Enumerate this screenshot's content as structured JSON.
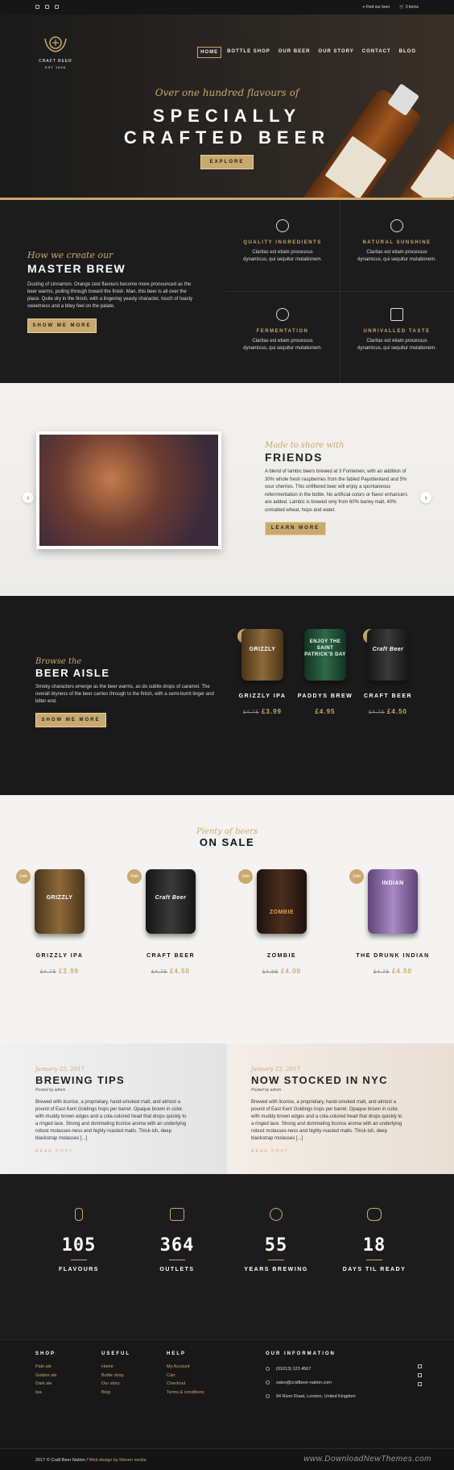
{
  "topbar": {
    "social_icons": [
      "instagram-icon",
      "facebook-icon",
      "twitter-icon"
    ],
    "find_beer": "Find our beer",
    "cart": "0 items"
  },
  "hero": {
    "brand": "CRAFT BEER",
    "established": "EST 1926",
    "nav": [
      "HOME",
      "BOTTLE SHOP",
      "OUR BEER",
      "OUR STORY",
      "CONTACT",
      "BLOG"
    ],
    "active_nav": "HOME",
    "tagline": "Over one hundred flavours of",
    "title_line1": "SPECIALLY",
    "title_line2": "CRAFTED BEER",
    "cta": "EXPLORE"
  },
  "brew": {
    "kicker": "How we create our",
    "title": "MASTER BREW",
    "text": "Dusting of cinnamon. Orange zest flavours become more pronounced as the beer warms, pulling through toward the finish. Man, this beer is all over the place. Quite dry in the finish, with a lingering yeasty character, touch of toasty sweetness and a bitey feel on the palate.",
    "cta": "SHOW ME MORE",
    "features": [
      {
        "title": "QUALITY INGREDIENTS",
        "text": "Claritas est etiam processus dynamicus, qui sequitur mutationem.",
        "icon": "hops-icon"
      },
      {
        "title": "NATURAL SUNSHINE",
        "text": "Claritas est etiam processus dynamicus, qui sequitur mutationem.",
        "icon": "sun-icon"
      },
      {
        "title": "FERMENTATION",
        "text": "Claritas est etiam processus dynamicus, qui sequitur mutationem.",
        "icon": "barrel-icon"
      },
      {
        "title": "UNRIVALLED TASTE",
        "text": "Claritas est etiam processus dynamicus, qui sequitur mutationem.",
        "icon": "crate-icon"
      }
    ]
  },
  "friends": {
    "kicker": "Made to share with",
    "title": "FRIENDS",
    "text": "A blend of lambic beers brewed at 3 Fonteinen, with an addition of 30% whole fresh raspberries from the fabled Payottenland and 5% sour cherries. This unfiltered beer will enjoy a spontaneous referrmentation in the bottle. No artificial colors or flavor enhancers are added. Lambic is brewed only from 60% barley malt, 40% unmalted wheat, hops and water.",
    "cta": "LEARN MORE",
    "prev": "‹",
    "next": "›"
  },
  "aisle": {
    "kicker": "Browse the",
    "title": "BEER AISLE",
    "text": "Smoky characters emerge as the beer warms, as do subtle drops of caramel. The overall dryness of the beer carries through to the finish, with a semi-burnt linger and bitter end.",
    "cta": "SHOW ME MORE",
    "sale_badge": "Sale",
    "products": [
      {
        "name": "GRIZZLY IPA",
        "old": "£4.75",
        "price": "£3.99",
        "sale": true,
        "can_label": "GRIZZLY",
        "color": "#7a5a32"
      },
      {
        "name": "PADDYS BREW",
        "old": "",
        "price": "£4.95",
        "sale": false,
        "can_label": "ENJOY THE SAINT PATRICK'S DAY",
        "color": "#1f4a33"
      },
      {
        "name": "CRAFT BEER",
        "old": "£4.75",
        "price": "£4.50",
        "sale": true,
        "can_label": "Craft Beer",
        "color": "#2a2a2a"
      }
    ]
  },
  "sale": {
    "kicker": "Plenty of beers",
    "title": "ON SALE",
    "badge": "Sale",
    "products": [
      {
        "name": "GRIZZLY IPA",
        "old": "£4.75",
        "price": "£2.99",
        "can_label": "GRIZZLY",
        "color": "#7a5a32"
      },
      {
        "name": "CRAFT BEER",
        "old": "£4.75",
        "price": "£4.50",
        "can_label": "Craft Beer",
        "color": "#2a2a2a"
      },
      {
        "name": "ZOMBIE",
        "old": "£4.95",
        "price": "£4.00",
        "can_label": "ZOMBIE",
        "color": "#3a2418"
      },
      {
        "name": "THE DRUNK INDIAN",
        "old": "£4.75",
        "price": "£4.50",
        "can_label": "INDIAN",
        "color": "#8a66a8"
      }
    ]
  },
  "blog": [
    {
      "date": "January 23, 2017",
      "title": "BREWING TIPS",
      "by": "Posted by admin",
      "text": "Brewed with licorice, a proprietary, hand-smoked malt, and almost a pound of East Kent Goldings hops per barrel. Opaque brown in color, with muddy brown edges and a cola-colored head that drops quickly to a ringed lace. Strong and dominating licorice aroma with an underlying robust molasses-ness and highly roasted malts. Thick-ish, deep blackstrap molasses [...]",
      "more": "READ POST"
    },
    {
      "date": "January 23, 2017",
      "title": "NOW STOCKED IN NYC",
      "by": "Posted by admin",
      "text": "Brewed with licorice, a proprietary, hand-smoked malt, and almost a pound of East Kent Goldings hops per barrel. Opaque brown in color, with muddy brown edges and a cola-colored head that drops quickly to a ringed lace. Strong and dominating licorice aroma with an underlying robust molasses-ness and highly roasted malts. Thick-ish, deep blackstrap molasses [...]",
      "more": "READ POST"
    }
  ],
  "stats": [
    {
      "num": "105",
      "label": "FLAVOURS",
      "icon": "can-icon"
    },
    {
      "num": "364",
      "label": "OUTLETS",
      "icon": "store-icon"
    },
    {
      "num": "55",
      "label": "YEARS BREWING",
      "icon": "badge-icon"
    },
    {
      "num": "18",
      "label": "DAYS TIL READY",
      "icon": "barrel-icon"
    }
  ],
  "footer": {
    "shop_title": "SHOP",
    "shop": [
      "Pale ale",
      "Golden ale",
      "Dark ale",
      "Ipa"
    ],
    "useful_title": "USEFUL",
    "useful": [
      "Home",
      "Bottle shop",
      "Our story",
      "Blog"
    ],
    "help_title": "HELP",
    "help": [
      "My Account",
      "Cart",
      "Checkout",
      "Terms & conditions"
    ],
    "info_title": "OUR INFORMATION",
    "phone": "(01013) 123 4567",
    "email": "sales@craftbeer-nation.com",
    "address": "94 River Road, London, United Kingdom",
    "copyright": "2017 © Craft Beer Nation / ",
    "credit": "Web design by Kleven media",
    "watermark": "www.DownloadNewThemes.com"
  }
}
